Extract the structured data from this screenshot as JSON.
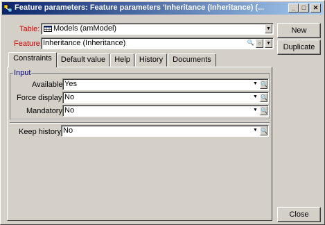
{
  "window": {
    "title": "Feature parameters: Feature parameters 'Inheritance (Inheritance) (...",
    "minimize_glyph": "_",
    "maximize_glyph": "□",
    "close_glyph": "✕"
  },
  "header": {
    "table_label": "Table:",
    "table_value": "Models (amModel)",
    "feature_label": "Feature:",
    "feature_value": "Inheritance (Inheritance)"
  },
  "buttons": {
    "new": "New",
    "duplicate": "Duplicate",
    "close": "Close"
  },
  "tabs": [
    {
      "label": "Constraints",
      "active": true
    },
    {
      "label": "Default value",
      "active": false
    },
    {
      "label": "Help",
      "active": false
    },
    {
      "label": "History",
      "active": false
    },
    {
      "label": "Documents",
      "active": false
    }
  ],
  "input_group": {
    "title": "Input",
    "fields": [
      {
        "label": "Available:",
        "value": "Yes"
      },
      {
        "label": "Force display:",
        "value": "No"
      },
      {
        "label": "Mandatory:",
        "value": "No"
      }
    ]
  },
  "keep_history": {
    "label": "Keep history:",
    "value": "No"
  },
  "colors": {
    "title_gradient_start": "#0a246a",
    "title_gradient_end": "#a6caf0",
    "required_label": "#cc0000",
    "face": "#d4d0c8"
  }
}
